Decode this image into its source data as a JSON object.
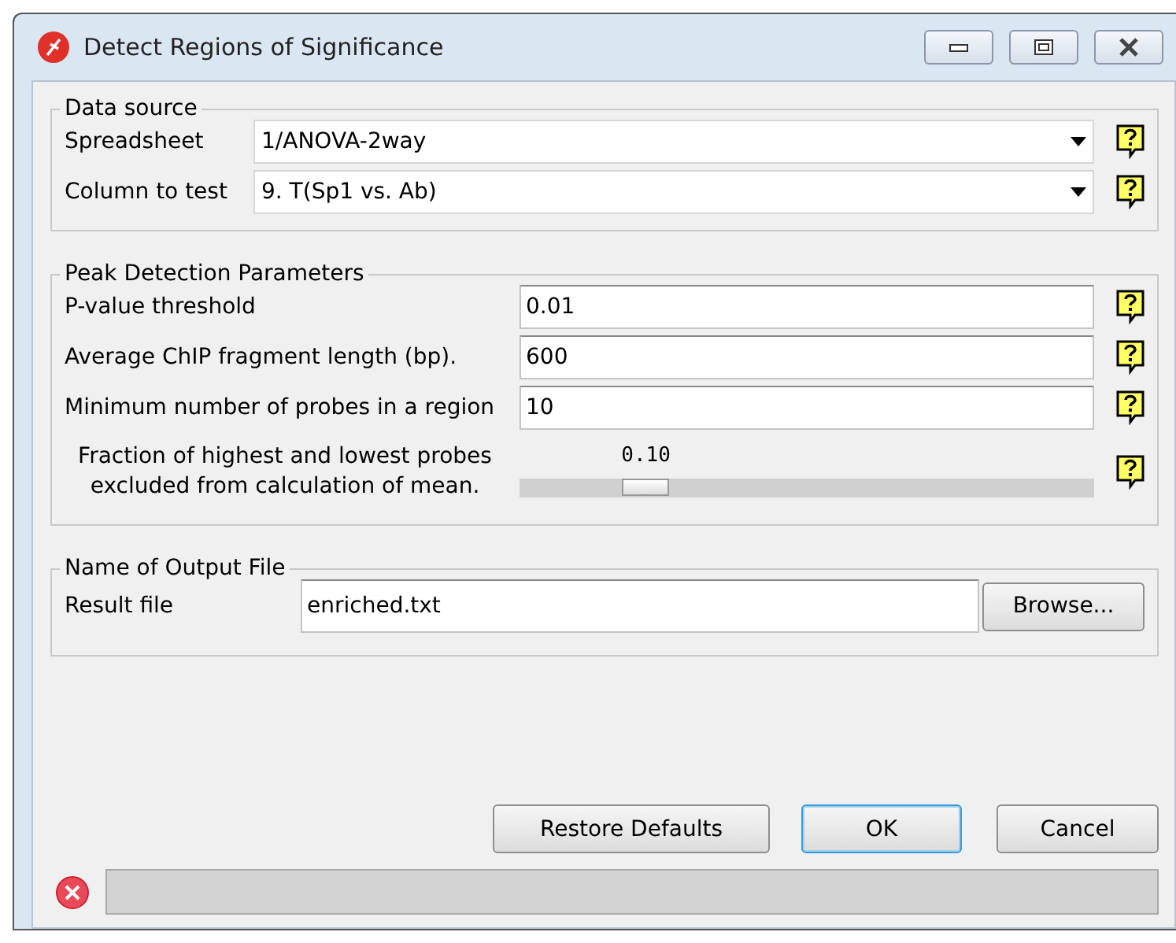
{
  "window": {
    "title": "Detect Regions of Significance"
  },
  "data_source": {
    "legend": "Data source",
    "rows": [
      {
        "label": "Spreadsheet",
        "value": "1/ANOVA-2way"
      },
      {
        "label": "Column to test",
        "value": "9. T(Sp1 vs. Ab)"
      }
    ]
  },
  "peak_detection": {
    "legend": "Peak Detection Parameters",
    "rows": [
      {
        "kind": "field",
        "label": "P-value threshold",
        "value": "0.01"
      },
      {
        "kind": "field",
        "label": "Average ChIP fragment length (bp).",
        "value": "600"
      },
      {
        "kind": "field",
        "label": "Minimum number of probes in a region",
        "value": "10"
      },
      {
        "kind": "slider",
        "label": "Fraction of highest and lowest probes excluded from calculation of mean.",
        "reading": "0.10",
        "level": 0.22
      }
    ]
  },
  "output": {
    "legend": "Name of Output File",
    "label": "Result file",
    "value": "enriched.txt",
    "browse": "Browse..."
  },
  "buttons": [
    {
      "label": "Restore Defaults",
      "default": false
    },
    {
      "label": "OK",
      "default": true
    },
    {
      "label": "Cancel",
      "default": false
    }
  ]
}
